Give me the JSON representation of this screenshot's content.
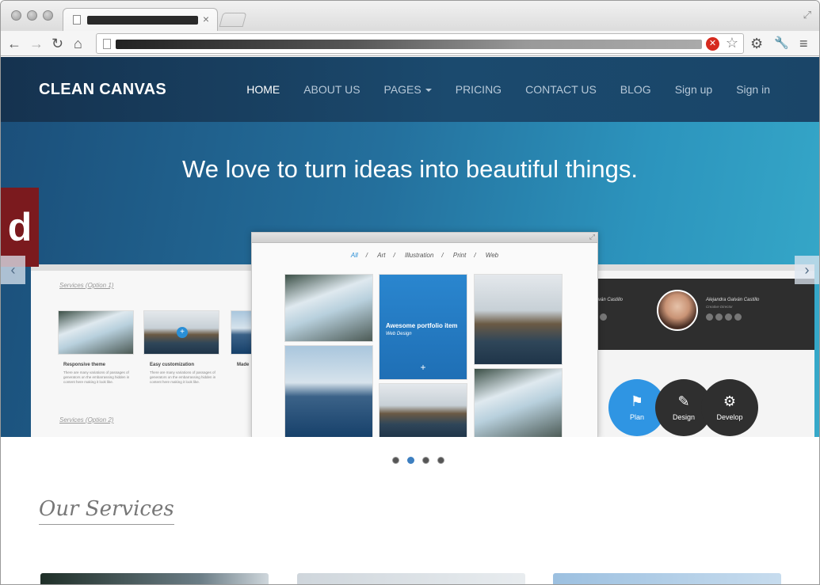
{
  "browser": {
    "tab_close": "×",
    "resize_glyph": "⤢",
    "back": "←",
    "forward": "→",
    "reload": "↻",
    "home": "⌂",
    "blocked_glyph": "✕",
    "star": "☆",
    "settings": "⚙",
    "wrench": "🔧",
    "menu": "≡"
  },
  "site": {
    "brand": "CLEAN CANVAS",
    "nav": [
      {
        "label": "HOME",
        "active": true
      },
      {
        "label": "ABOUT US"
      },
      {
        "label": "PAGES"
      },
      {
        "label": "PRICING"
      },
      {
        "label": "CONTACT US"
      },
      {
        "label": "BLOG"
      },
      {
        "label": "Sign up"
      },
      {
        "label": "Sign in"
      }
    ]
  },
  "hero": {
    "headline": "We love to turn ideas into beautiful things.",
    "badge": "d",
    "prev": "‹",
    "next": "›",
    "filters": [
      "All",
      "Art",
      "Illustration",
      "Print",
      "Web"
    ],
    "filter_sep": "/",
    "portfolio_caption": "Awesome portfolio item",
    "portfolio_sub": "Web Design",
    "plus": "+",
    "services_option1": "Services (Option 1)",
    "services_option2": "Services (Option 2)",
    "mini_titles": [
      "Responsive theme",
      "Easy customization",
      "Made"
    ],
    "mini_text": "There are many variations of passages of generators on the embarrassing hidden in content here making it look like.",
    "person_name": "Alejandra Galván Castillo",
    "person_role": "Creative Director",
    "person_name_partial": "ván Castillo",
    "circles": [
      {
        "label": "Plan",
        "icon": "⚑"
      },
      {
        "label": "Design",
        "icon": "✎"
      },
      {
        "label": "Develop",
        "icon": "⚙"
      }
    ]
  },
  "slider": {
    "count": 4,
    "active": 1
  },
  "services": {
    "title": "Our Services"
  },
  "colors": {
    "header_bg": "#15324f",
    "accent_blue": "#2a8fd6",
    "badge_red": "#7b1a1e"
  }
}
